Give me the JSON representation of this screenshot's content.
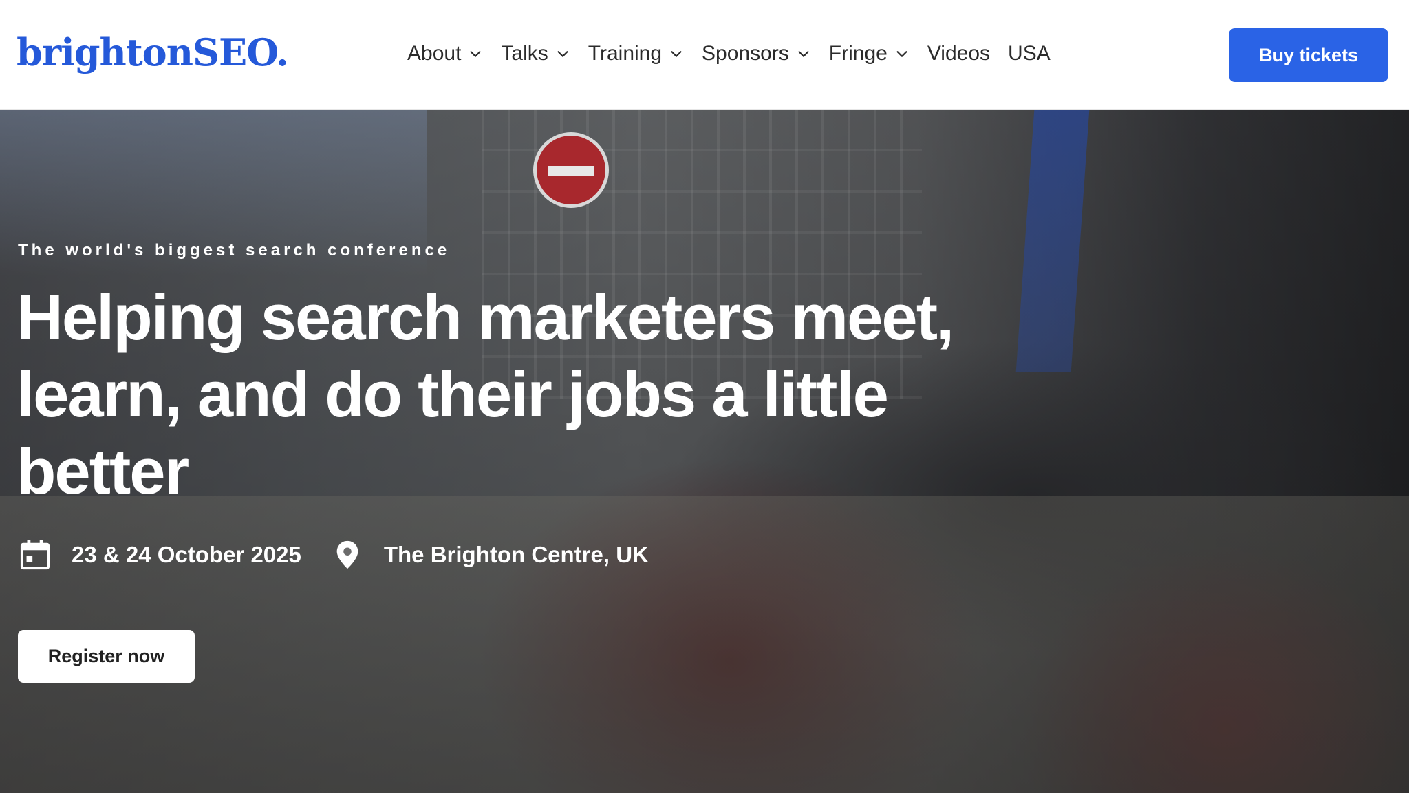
{
  "header": {
    "logo_text": "brightonSEO.",
    "nav": [
      {
        "label": "About",
        "has_dropdown": true,
        "icon": "chevron-down-icon"
      },
      {
        "label": "Talks",
        "has_dropdown": true,
        "icon": "chevron-down-icon"
      },
      {
        "label": "Training",
        "has_dropdown": true,
        "icon": "chevron-down-icon"
      },
      {
        "label": "Sponsors",
        "has_dropdown": true,
        "icon": "chevron-down-icon"
      },
      {
        "label": "Fringe",
        "has_dropdown": true,
        "icon": "chevron-down-icon"
      },
      {
        "label": "Videos",
        "has_dropdown": false
      },
      {
        "label": "USA",
        "has_dropdown": false
      }
    ],
    "cta_label": "Buy tickets"
  },
  "hero": {
    "eyebrow": "The world's biggest search conference",
    "title": "Helping search marketers meet, learn, and do their jobs a little better",
    "date": {
      "icon": "calendar-icon",
      "text": "23 & 24 October 2025"
    },
    "location": {
      "icon": "map-pin-icon",
      "text": "The Brighton Centre, UK"
    },
    "cta_label": "Register now"
  },
  "colors": {
    "brand_blue": "#2559d9",
    "button_blue": "#2a63e6",
    "white": "#ffffff",
    "nav_text": "#2b2b2b"
  }
}
